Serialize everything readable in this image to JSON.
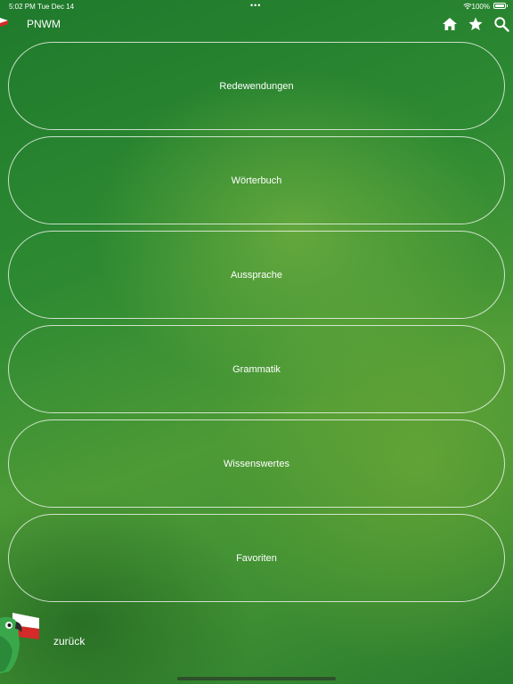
{
  "status_bar": {
    "time": "5:02 PM",
    "date": "Tue Dec 14",
    "dots": "•••",
    "battery": "100%"
  },
  "header": {
    "title": "PNWM",
    "icons": [
      "home-icon",
      "star-icon",
      "search-icon"
    ]
  },
  "menu": {
    "items": [
      {
        "label": "Redewendungen"
      },
      {
        "label": "Wörterbuch"
      },
      {
        "label": "Aussprache"
      },
      {
        "label": "Grammatik"
      },
      {
        "label": "Wissenswertes"
      },
      {
        "label": "Favoriten"
      }
    ]
  },
  "footer": {
    "back_label": "zurück"
  },
  "colors": {
    "background": "#2e8a32",
    "text": "#ffffff",
    "flag_red": "#d42a2a",
    "parrot_green": "#3aa84a"
  }
}
